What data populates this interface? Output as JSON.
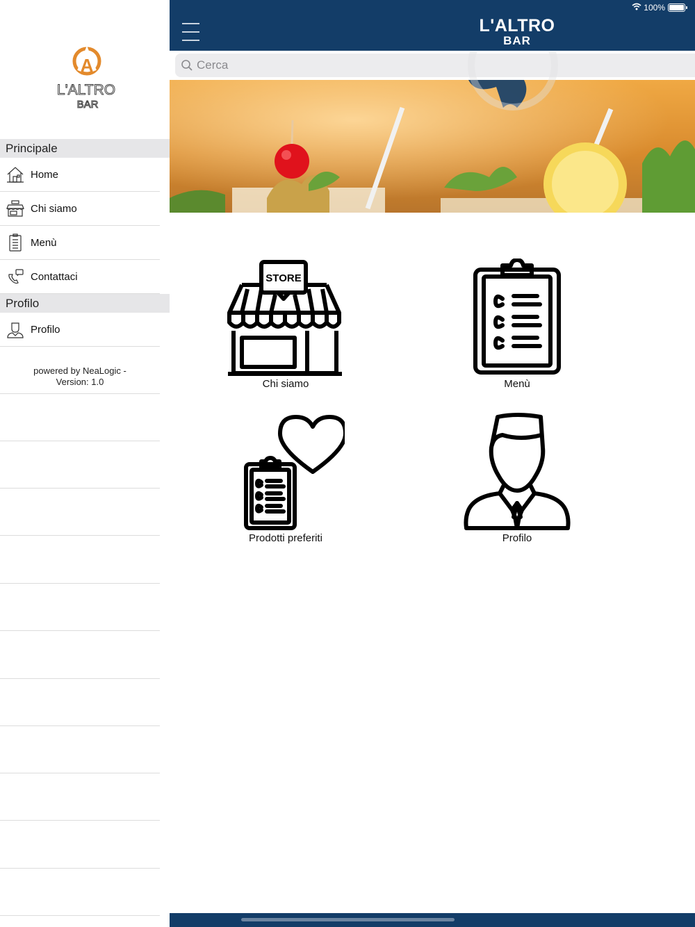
{
  "status": {
    "battery": "100%"
  },
  "brand": {
    "line1": "L'ALTRO",
    "line2": "BAR",
    "color": "#133d68",
    "accent": "#e38a2c"
  },
  "sidebar": {
    "logo": {
      "line1": "L'ALTRO",
      "line2": "BAR",
      "letter": "A"
    },
    "sections": [
      {
        "title": "Principale",
        "items": [
          {
            "label": "Home",
            "icon": "home-icon"
          },
          {
            "label": "Chi siamo",
            "icon": "store-icon"
          },
          {
            "label": "Menù",
            "icon": "clipboard-icon"
          },
          {
            "label": "Contattaci",
            "icon": "phone-icon"
          }
        ]
      },
      {
        "title": "Profilo",
        "items": [
          {
            "label": "Profilo",
            "icon": "user-icon"
          }
        ]
      }
    ],
    "powered": {
      "line1": "powered by NeaLogic -",
      "line2": "Version: 1.0"
    }
  },
  "search": {
    "placeholder": "Cerca"
  },
  "tiles": [
    {
      "label": "Chi siamo",
      "icon": "store-icon",
      "store_text": "STORE"
    },
    {
      "label": "Menù",
      "icon": "clipboard-icon"
    },
    {
      "label": "Prodotti preferiti",
      "icon": "favorites-icon"
    },
    {
      "label": "Profilo",
      "icon": "user-icon"
    }
  ]
}
